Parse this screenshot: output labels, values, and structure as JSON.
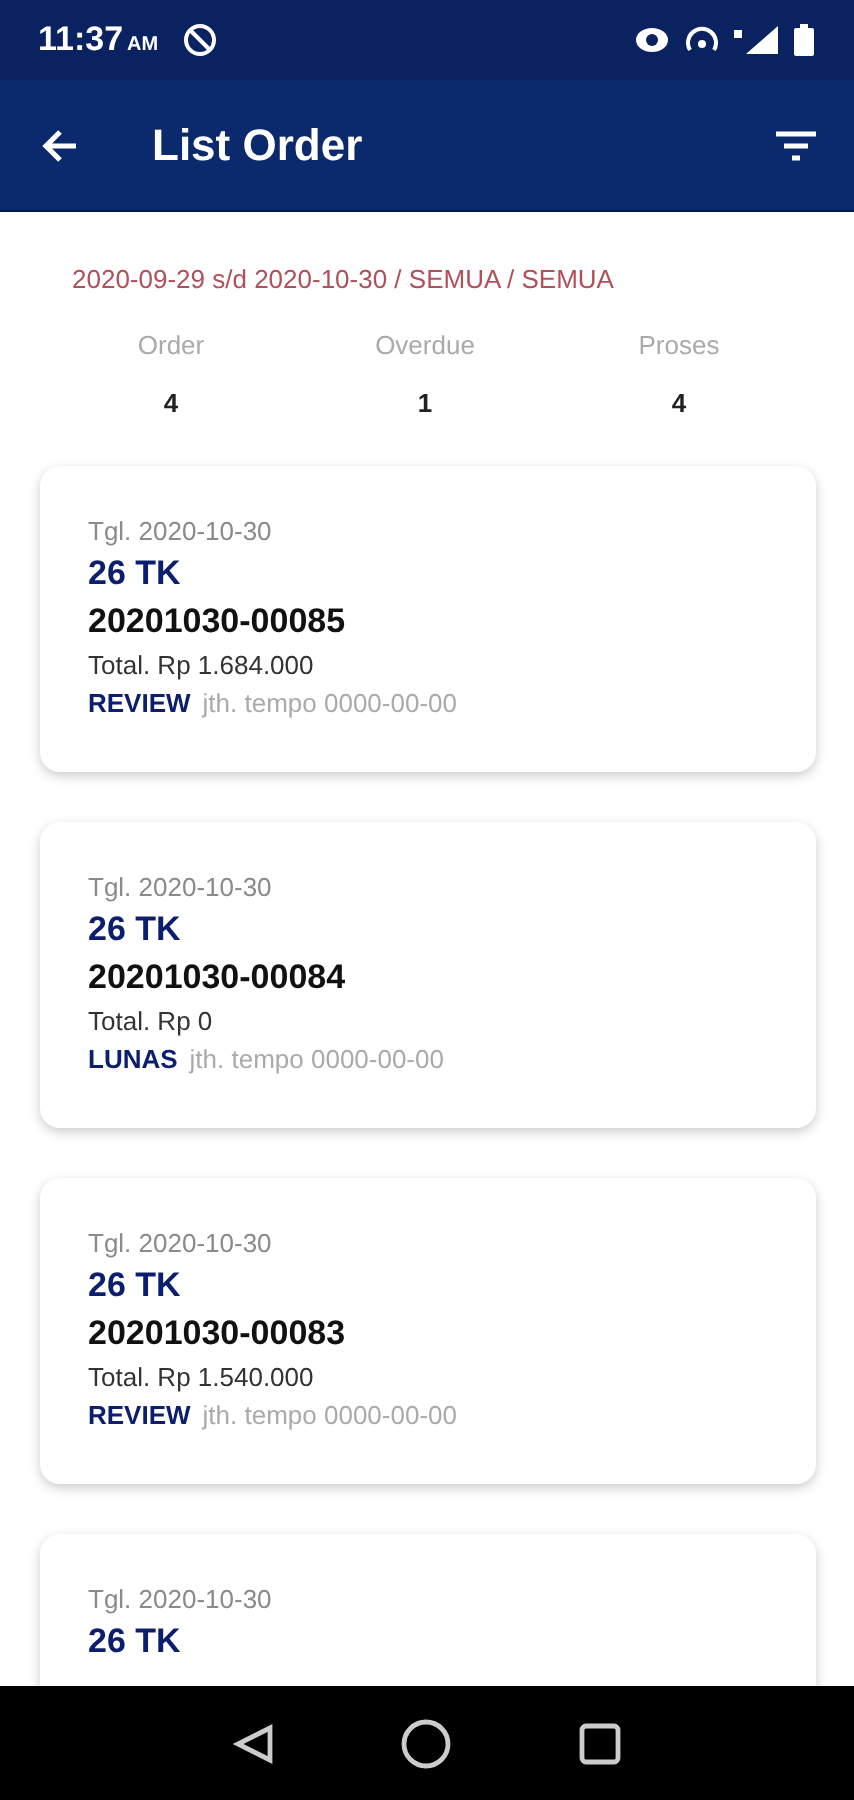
{
  "status_bar": {
    "time": "11:37",
    "ampm": "AM"
  },
  "app_bar": {
    "title": "List Order"
  },
  "filter_summary": "2020-09-29 s/d 2020-10-30 / SEMUA / SEMUA",
  "stats": [
    {
      "label": "Order",
      "value": "4"
    },
    {
      "label": "Overdue",
      "value": "1"
    },
    {
      "label": "Proses",
      "value": "4"
    }
  ],
  "orders": [
    {
      "date": "Tgl. 2020-10-30",
      "customer": "26 TK",
      "number": "20201030-00085",
      "total": "Total. Rp 1.684.000",
      "status": "REVIEW",
      "due": "jth. tempo 0000-00-00"
    },
    {
      "date": "Tgl. 2020-10-30",
      "customer": "26 TK",
      "number": "20201030-00084",
      "total": "Total. Rp 0",
      "status": "LUNAS",
      "due": "jth. tempo 0000-00-00"
    },
    {
      "date": "Tgl. 2020-10-30",
      "customer": "26 TK",
      "number": "20201030-00083",
      "total": "Total. Rp 1.540.000",
      "status": "REVIEW",
      "due": "jth. tempo 0000-00-00"
    },
    {
      "date": "Tgl. 2020-10-30",
      "customer": "26 TK"
    }
  ]
}
